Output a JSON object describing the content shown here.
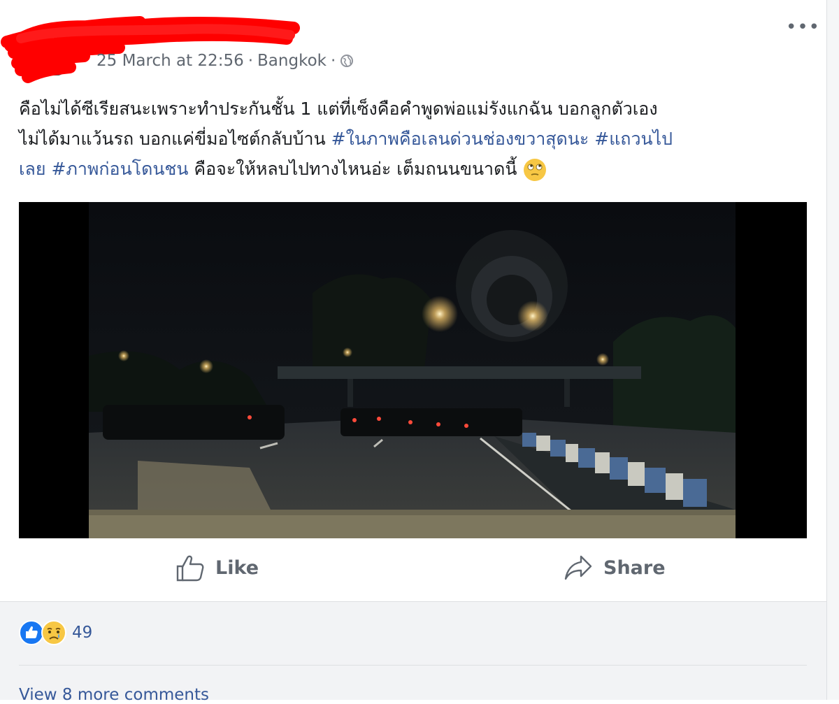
{
  "post": {
    "timestamp": "25 March at 22:56",
    "separator": "·",
    "location": "Bangkok",
    "more_label": "•••",
    "text": {
      "line1": "คือไม่ได้ซีเรียสนะเพราะทำประกันชั้น 1 แต่ที่เซ็งคือคำพูดพ่อแม่รังแกฉัน บอกลูกตัวเอง",
      "line2_plain": "ไม่ได้มาแว้นรถ บอกแค่ขี่มอไซต์กลับบ้าน ",
      "hashtag1": "#ในภาพคือเลนด่วนช่องขวาสุดนะ",
      "space1": " ",
      "hashtag2": "#แถวนไป",
      "line3_hashtag_cont": "เลย",
      "space2": " ",
      "hashtag3": "#ภาพก่อนโดนชน",
      "line3_plain": " คือจะให้หลบไปทางไหนอ่ะ เต็มถนนขนาดนี้ "
    },
    "media": {
      "type": "video",
      "description_icon": "dashcam-night-road"
    }
  },
  "actions": {
    "like_label": "Like",
    "share_label": "Share"
  },
  "reactions": {
    "icons": [
      "like-reaction-icon",
      "sad-reaction-icon"
    ],
    "count": "49"
  },
  "comments": {
    "view_more_label": "View 8 more comments"
  },
  "colors": {
    "link": "#365899",
    "meta": "#606770",
    "text": "#1c1e21",
    "like_blue": "#1877f2",
    "sad_yellow": "#f7c744"
  }
}
